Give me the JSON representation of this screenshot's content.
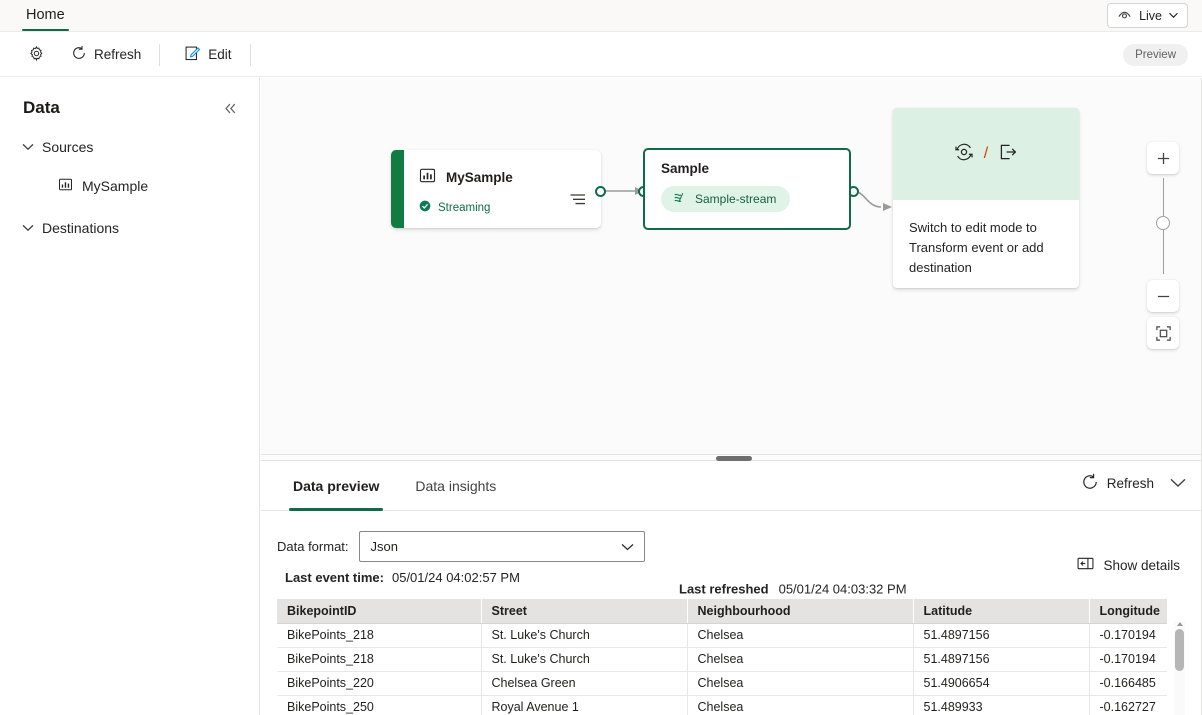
{
  "ribbon": {
    "tab_home": "Home",
    "live_label": "Live",
    "live_icon": "eye-icon",
    "chevron_icon": "chevron-down-icon"
  },
  "commandbar": {
    "settings_icon": "gear-icon",
    "refresh_label": "Refresh",
    "refresh_icon": "refresh-icon",
    "edit_label": "Edit",
    "edit_icon": "edit-pencil-icon",
    "preview_badge": "Preview"
  },
  "sidebar": {
    "title": "Data",
    "collapse_icon": "double-chevron-left-icon",
    "groups": [
      {
        "label": "Sources",
        "expanded": true,
        "children": [
          {
            "label": "MySample",
            "icon": "chart-icon"
          }
        ]
      },
      {
        "label": "Destinations",
        "expanded": true,
        "children": []
      }
    ]
  },
  "canvas": {
    "source_node": {
      "title": "MySample",
      "icon": "chart-icon",
      "status": "Streaming",
      "status_icon": "check-circle-icon",
      "menu_icon": "list-lines-icon",
      "accent_color": "#107c41"
    },
    "stream_node": {
      "title": "Sample",
      "pill_label": "Sample-stream",
      "pill_icon": "stream-icon",
      "border_color": "#0f6b47"
    },
    "hint_node": {
      "icon_transform": "transform-icon",
      "icon_separator": "/",
      "icon_destination": "export-destination-icon",
      "text": "Switch to edit mode to Transform event or add destination"
    },
    "zoom_controls": {
      "zoom_in": "plus-icon",
      "zoom_out": "minus-icon",
      "fit_to_screen": "fit-to-screen-icon"
    }
  },
  "bottom_panel": {
    "tabs": [
      {
        "label": "Data preview",
        "active": true
      },
      {
        "label": "Data insights",
        "active": false
      }
    ],
    "refresh_label": "Refresh",
    "refresh_icon": "refresh-icon",
    "collapse_icon": "chevron-down-icon",
    "data_format_label": "Data format:",
    "data_format_value": "Json",
    "data_format_options": [
      "Json"
    ],
    "last_refreshed_label": "Last refreshed",
    "last_refreshed_value": "05/01/24 04:03:32 PM",
    "last_event_time_label": "Last event time:",
    "last_event_time_value": "05/01/24 04:02:57 PM",
    "show_details_label": "Show details",
    "show_details_icon": "panel-details-icon",
    "table": {
      "columns": [
        "BikepointID",
        "Street",
        "Neighbourhood",
        "Latitude",
        "Longitude"
      ],
      "rows": [
        [
          "BikePoints_218",
          "St. Luke's Church",
          "Chelsea",
          "51.4897156",
          "-0.170194"
        ],
        [
          "BikePoints_218",
          "St. Luke's Church",
          "Chelsea",
          "51.4897156",
          "-0.170194"
        ],
        [
          "BikePoints_220",
          "Chelsea Green",
          "Chelsea",
          "51.4906654",
          "-0.166485"
        ],
        [
          "BikePoints_250",
          "Royal Avenue 1",
          "Chelsea",
          "51.489933",
          "-0.162727"
        ]
      ]
    }
  },
  "colors": {
    "accent_green": "#0f6b47",
    "source_green": "#107c41",
    "pill_green_bg": "#dff3e7",
    "hint_green_bg": "#ddf0e4",
    "edit_blue": "#0f78d4",
    "slash_orange": "#d83b01"
  }
}
